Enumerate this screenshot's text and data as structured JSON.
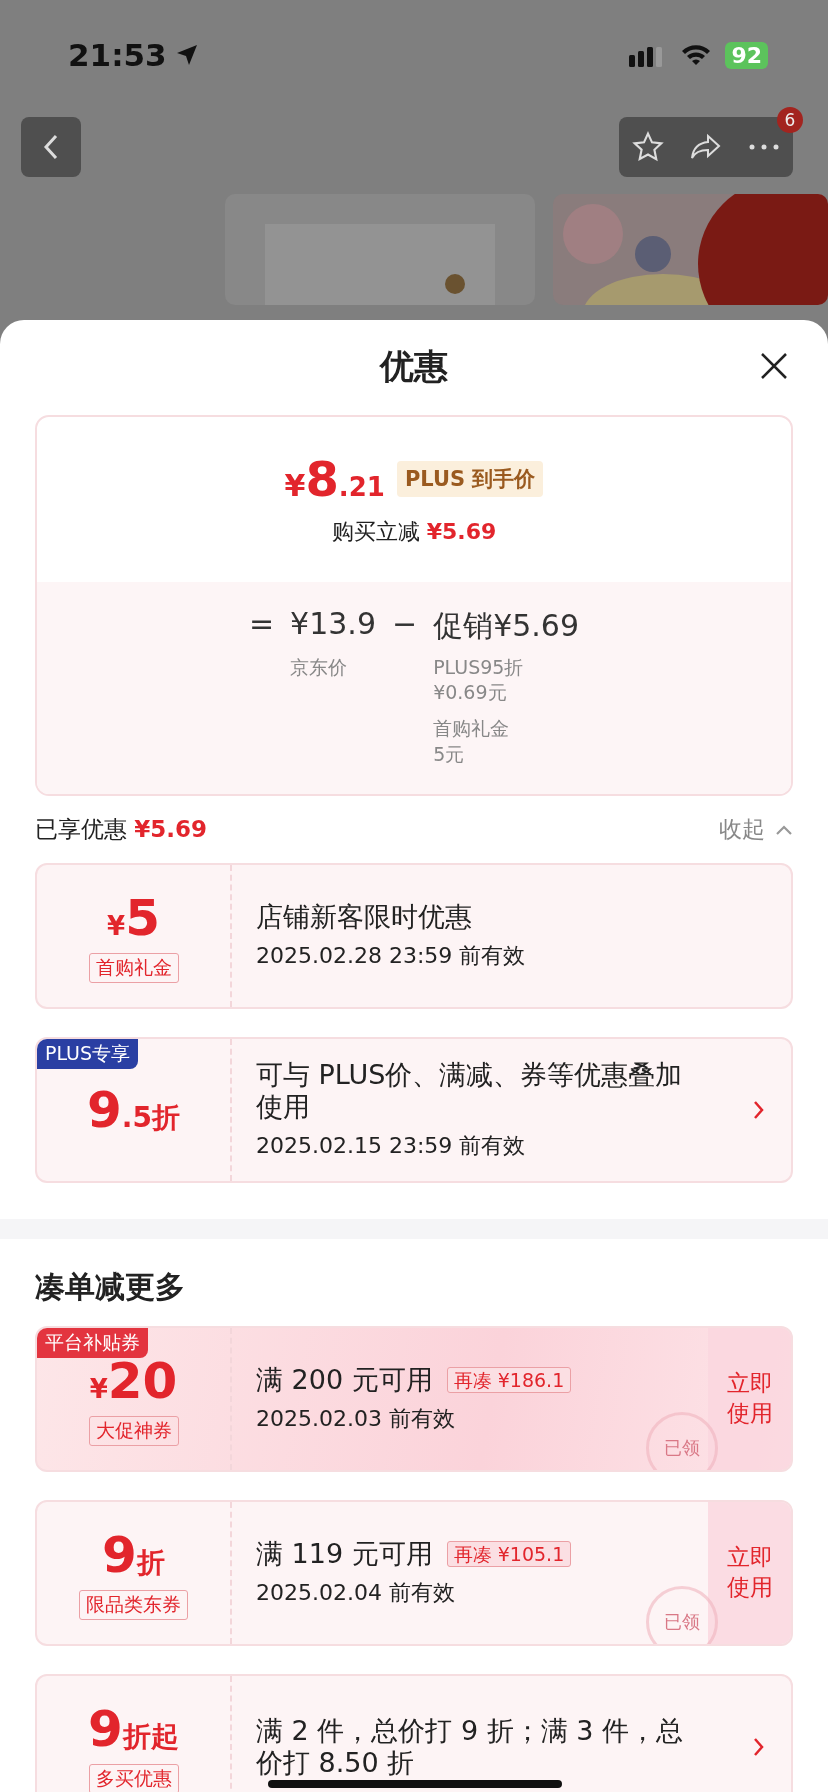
{
  "status_bar": {
    "time": "21:53",
    "battery": "92"
  },
  "nav": {
    "badge": "6"
  },
  "sheet": {
    "title": "优惠",
    "price_card": {
      "currency": "¥",
      "integer": "8",
      "decimal": ".21",
      "tag": "PLUS 到手价",
      "saving_label": "购买立减",
      "saving_value": "¥5.69",
      "equation": {
        "equals": "=",
        "base": "¥13.9",
        "base_label": "京东价",
        "minus": "−",
        "promo": "促销¥5.69",
        "details": [
          {
            "lines": [
              "PLUS95折",
              "¥0.69元"
            ]
          },
          {
            "lines": [
              "首购礼金",
              "5元"
            ]
          }
        ]
      }
    },
    "enjoyed": {
      "label": "已享优惠",
      "amount": "¥5.69",
      "toggle": "收起",
      "expanded": true
    },
    "enjoyed_coupons": [
      {
        "prefix": "¥",
        "big": "5",
        "label": "首购礼金",
        "title": "店铺新客限时优惠",
        "validity": "2025.02.28 23:59 前有效",
        "link": false,
        "highlight": false
      },
      {
        "badge": {
          "text": "PLUS专享",
          "kind": "plus"
        },
        "big": "9",
        "suffix": ".5折",
        "title": "可与 PLUS价、满减、券等优惠叠加使用",
        "validity": "2025.02.15 23:59 前有效",
        "link": true,
        "highlight": false
      }
    ],
    "more_title": "凑单减更多",
    "more_coupons": [
      {
        "badge": {
          "text": "平台补贴券",
          "kind": "platform"
        },
        "prefix": "¥",
        "big": "20",
        "label": "大促神券",
        "title": "满 200 元可用",
        "extra": "再凑 ¥186.1",
        "validity": "2025.02.03 前有效",
        "action": "立即使用",
        "stamp": "已领",
        "link": false,
        "highlight": true
      },
      {
        "big": "9",
        "suffix": "折",
        "label": "限品类东券",
        "title": "满 119 元可用",
        "extra": "再凑 ¥105.1",
        "validity": "2025.02.04 前有效",
        "action": "立即使用",
        "stamp": "已领",
        "link": false,
        "highlight": false
      },
      {
        "big": "9",
        "suffix": "折起",
        "label": "多买优惠",
        "title": "满 2 件，总价打 9 折；满 3 件，总价打 8.50 折",
        "link": true,
        "highlight": false
      }
    ]
  }
}
